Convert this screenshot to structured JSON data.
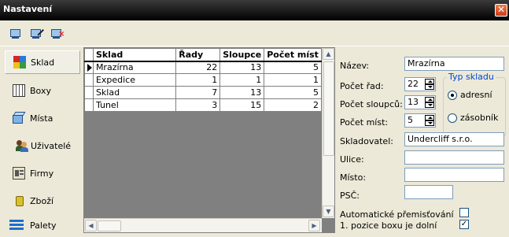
{
  "window": {
    "title": "Nastavení",
    "close_label": "✕"
  },
  "toolbar": {
    "icons": [
      "new-record-icon",
      "edit-record-icon",
      "delete-record-icon"
    ]
  },
  "nav": {
    "items": [
      {
        "label": "Sklad",
        "active": true
      },
      {
        "label": "Boxy"
      },
      {
        "label": "Místa"
      },
      {
        "label": "Uživatelé"
      },
      {
        "label": "Firmy"
      },
      {
        "label": "Zboží"
      },
      {
        "label": "Palety"
      }
    ]
  },
  "grid": {
    "columns": [
      "Sklad",
      "Řady",
      "Sloupce",
      "Počet míst"
    ],
    "rows": [
      {
        "name": "Mrazírna",
        "rady": "22",
        "sloupce": "13",
        "mist": "5"
      },
      {
        "name": "Expedice",
        "rady": "1",
        "sloupce": "1",
        "mist": "1"
      },
      {
        "name": "Sklad",
        "rady": "7",
        "sloupce": "13",
        "mist": "5"
      },
      {
        "name": "Tunel",
        "rady": "3",
        "sloupce": "15",
        "mist": "2"
      }
    ],
    "selected_row": 0
  },
  "form": {
    "nazev_label": "Název:",
    "nazev_value": "Mrazírna",
    "pocet_rad_label": "Počet řad:",
    "pocet_rad_value": "22",
    "pocet_sloupcu_label": "Počet sloupců:",
    "pocet_sloupcu_value": "13",
    "pocet_mist_label": "Počet míst:",
    "pocet_mist_value": "5",
    "typ_skladu_title": "Typ skladu",
    "typ_adresni_label": "adresní",
    "typ_zasobnik_label": "zásobník",
    "typ_selected": "adresní",
    "skladovatel_label": "Skladovatel:",
    "skladovatel_value": "Undercliff s.r.o.",
    "ulice_label": "Ulice:",
    "ulice_value": "",
    "misto_label": "Místo:",
    "misto_value": "",
    "psc_label": "PSČ:",
    "psc_value": "",
    "auto_presun_label": "Automatické přemisťování",
    "auto_presun_checked": false,
    "pozice_dolni_label": "1. pozice boxu je dolní",
    "pozice_dolni_checked": true,
    "check_mark": "✓"
  },
  "colors": {
    "titlebar": "#000000",
    "close": "#e0592b",
    "group_title": "#0046d5"
  }
}
